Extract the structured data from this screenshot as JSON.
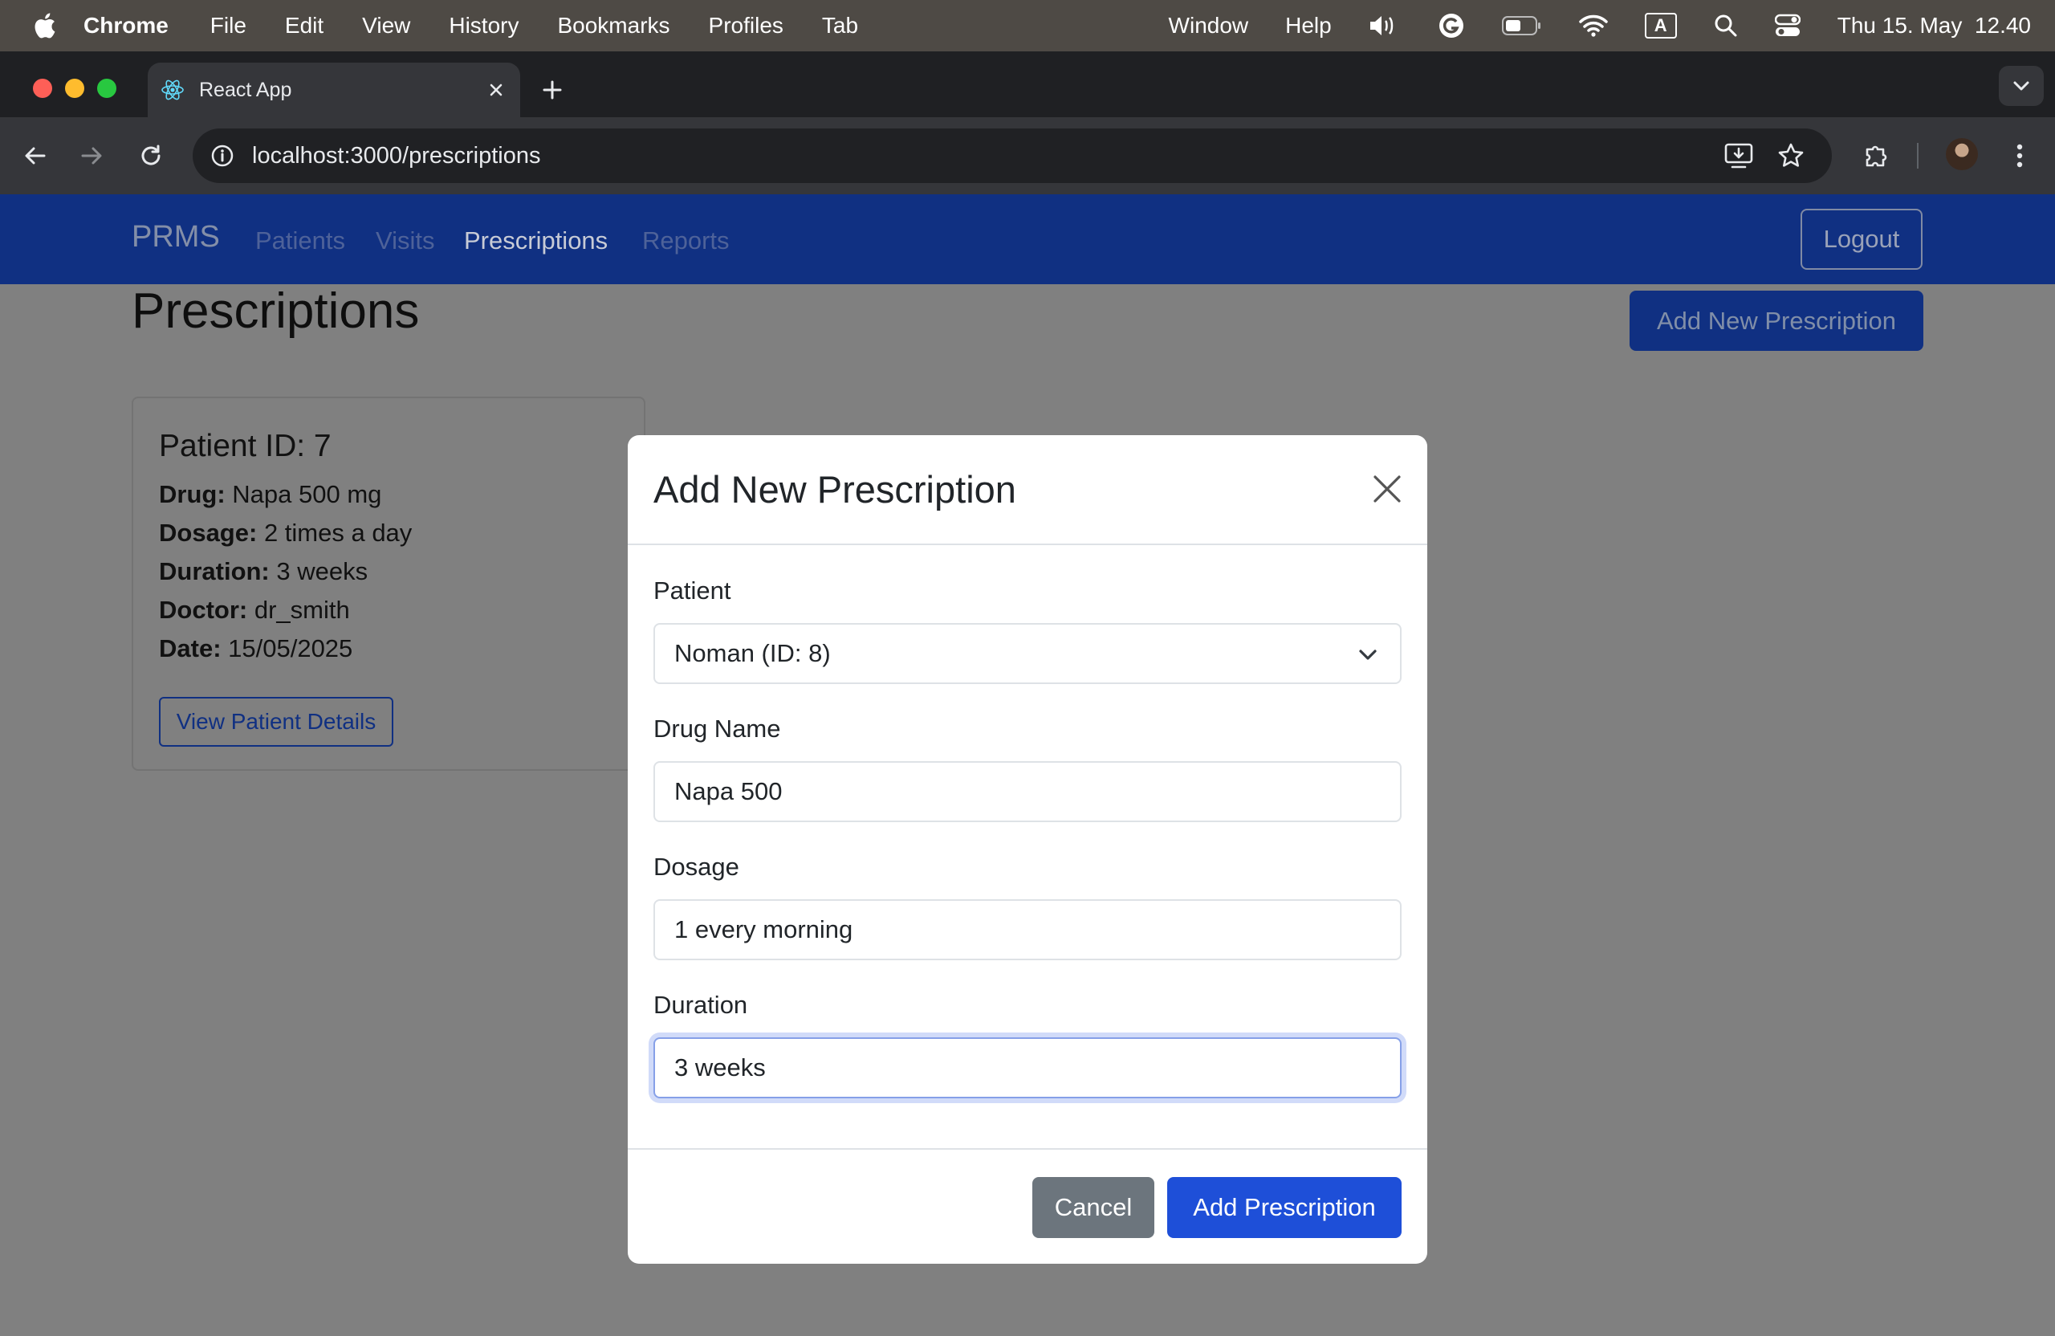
{
  "menubar": {
    "app": "Chrome",
    "items": [
      "File",
      "Edit",
      "View",
      "History",
      "Bookmarks",
      "Profiles",
      "Tab"
    ],
    "right_items": [
      "Window",
      "Help"
    ],
    "input_indicator": "A",
    "clock": "Thu 15. May  12.40"
  },
  "browser": {
    "tab_title": "React App",
    "url": "localhost:3000/prescriptions"
  },
  "app": {
    "brand": "PRMS",
    "nav": [
      "Patients",
      "Visits",
      "Prescriptions",
      "Reports"
    ],
    "active_nav": "Prescriptions",
    "logout_label": "Logout",
    "page_title": "Prescriptions",
    "add_new_label": "Add New Prescription",
    "card": {
      "title": "Patient ID: 7",
      "rows": [
        {
          "label": "Drug:",
          "value": "Napa 500 mg"
        },
        {
          "label": "Dosage:",
          "value": "2 times a day"
        },
        {
          "label": "Duration:",
          "value": "3 weeks"
        },
        {
          "label": "Doctor:",
          "value": "dr_smith"
        },
        {
          "label": "Date:",
          "value": "15/05/2025"
        }
      ],
      "button_label": "View Patient Details"
    }
  },
  "modal": {
    "title": "Add New Prescription",
    "patient_label": "Patient",
    "patient_value": "Noman (ID: 8)",
    "drug_label": "Drug Name",
    "drug_value": "Napa 500",
    "dosage_label": "Dosage",
    "dosage_value": "1 every morning",
    "duration_label": "Duration",
    "duration_value": "3 weeks",
    "cancel_label": "Cancel",
    "submit_label": "Add Prescription"
  },
  "colors": {
    "navbar": "#1a49c9",
    "primary": "#1e4fd8",
    "secondary": "#6c757d",
    "backdrop": "#808080"
  }
}
